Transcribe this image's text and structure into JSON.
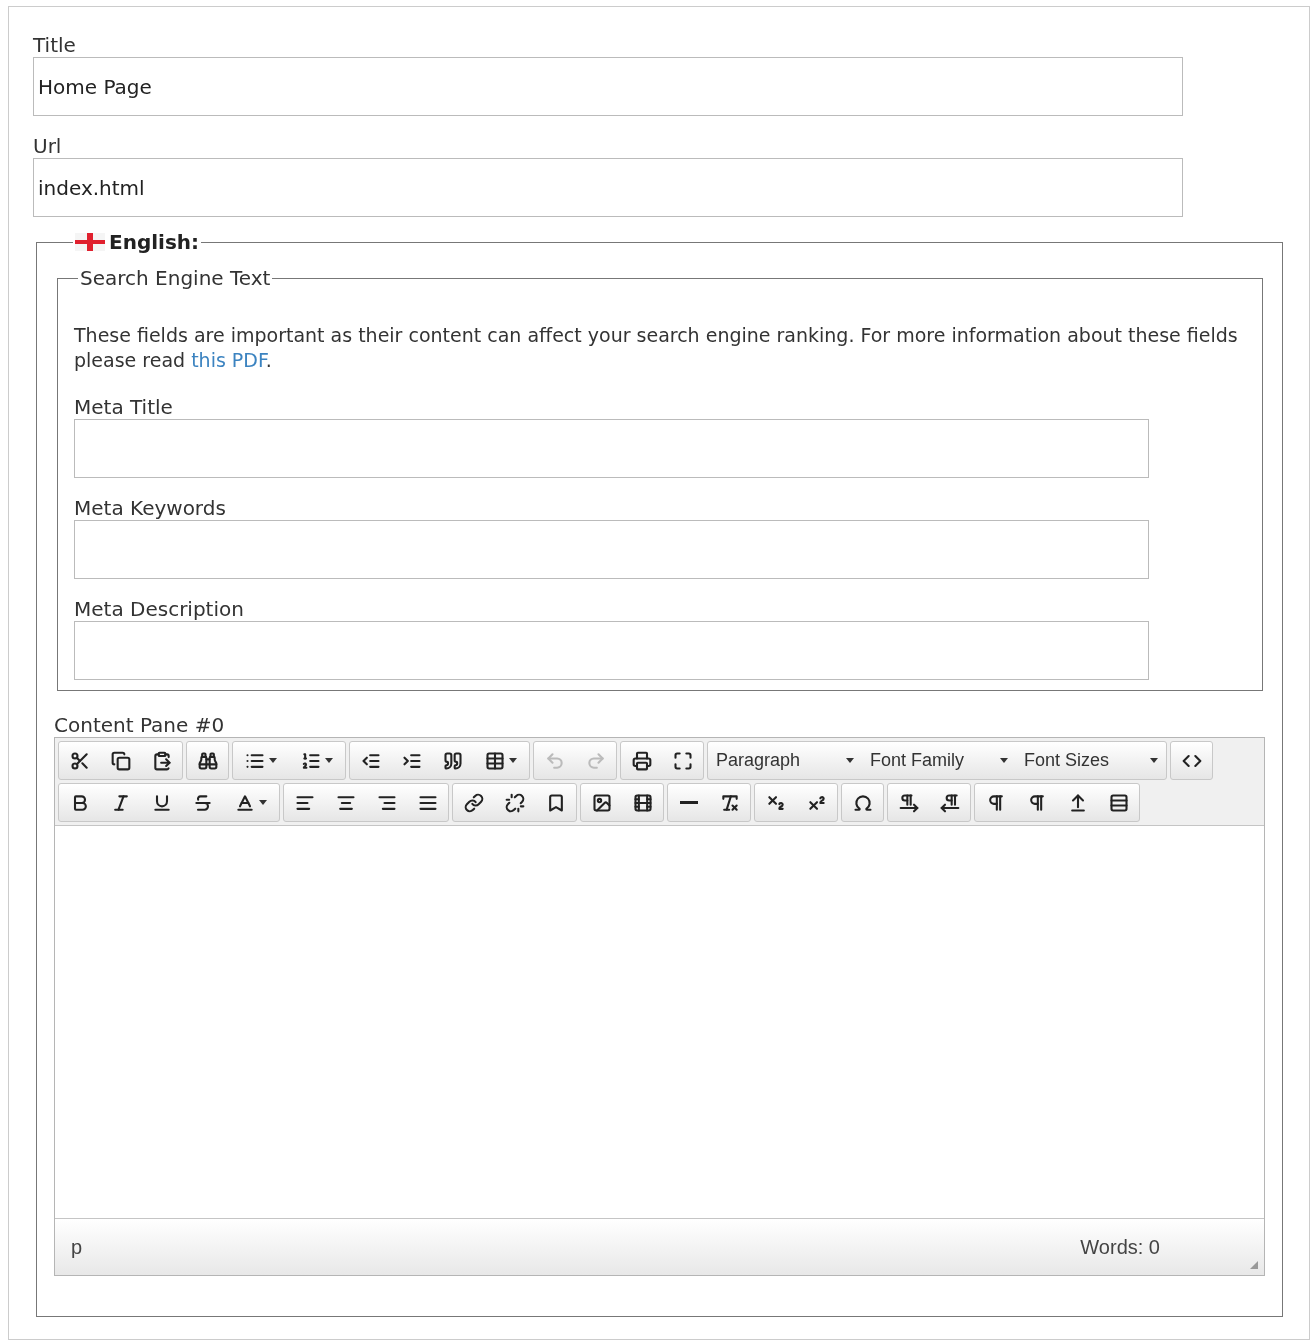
{
  "fields": [
    {
      "label": "Title",
      "value": "Home Page"
    },
    {
      "label": "Url",
      "value": "index.html"
    }
  ],
  "language": {
    "legend": "English:"
  },
  "seo": {
    "legend": "Search Engine Text",
    "intro": "These fields are important as their content can affect your search engine ranking. For more information about these fields please read ",
    "link": "this PDF",
    "intro_end": ".",
    "fields": [
      {
        "label": "Meta Title"
      },
      {
        "label": "Meta Keywords"
      },
      {
        "label": "Meta Description"
      }
    ]
  },
  "editor": {
    "label": "Content Pane #0",
    "toolbar": [
      [
        [
          {
            "kind": "button",
            "disabled": false
          },
          {
            "kind": "button",
            "disabled": false
          },
          {
            "kind": "button",
            "disabled": false
          }
        ],
        [
          {
            "kind": "button",
            "disabled": false
          }
        ],
        [
          {
            "kind": "split",
            "disabled": false
          },
          {
            "kind": "split",
            "disabled": false
          }
        ],
        [
          {
            "kind": "button",
            "disabled": false
          },
          {
            "kind": "button",
            "disabled": false
          },
          {
            "kind": "button",
            "disabled": false
          },
          {
            "kind": "split",
            "disabled": false
          }
        ],
        [
          {
            "kind": "button",
            "disabled": true
          },
          {
            "kind": "button",
            "disabled": true
          }
        ],
        [
          {
            "kind": "button",
            "disabled": false
          },
          {
            "kind": "button",
            "disabled": false
          }
        ],
        [
          {
            "kind": "menu",
            "label": "Paragraph"
          },
          {
            "kind": "menu",
            "label": "Font Family"
          },
          {
            "kind": "menu",
            "label": "Font Sizes"
          }
        ],
        [
          {
            "kind": "button",
            "disabled": false
          }
        ]
      ],
      [
        [
          {
            "kind": "button",
            "disabled": false
          },
          {
            "kind": "button",
            "disabled": false
          },
          {
            "kind": "button",
            "disabled": false
          },
          {
            "kind": "button",
            "disabled": false
          },
          {
            "kind": "split",
            "disabled": false
          }
        ],
        [
          {
            "kind": "button",
            "disabled": false
          },
          {
            "kind": "button",
            "disabled": false
          },
          {
            "kind": "button",
            "disabled": false
          },
          {
            "kind": "button",
            "disabled": false
          }
        ],
        [
          {
            "kind": "button",
            "disabled": false
          },
          {
            "kind": "button",
            "disabled": false
          },
          {
            "kind": "button",
            "disabled": false
          }
        ],
        [
          {
            "kind": "button",
            "disabled": false
          },
          {
            "kind": "button",
            "disabled": false
          }
        ],
        [
          {
            "kind": "button",
            "disabled": false
          },
          {
            "kind": "button",
            "disabled": false
          }
        ],
        [
          {
            "kind": "button",
            "disabled": false
          },
          {
            "kind": "button",
            "disabled": false
          }
        ],
        [
          {
            "kind": "button",
            "disabled": false
          }
        ],
        [
          {
            "kind": "button",
            "disabled": false
          },
          {
            "kind": "button",
            "disabled": false
          }
        ],
        [
          {
            "kind": "button",
            "disabled": false
          },
          {
            "kind": "button",
            "disabled": false
          },
          {
            "kind": "button",
            "disabled": false
          },
          {
            "kind": "button",
            "disabled": false
          }
        ]
      ]
    ],
    "path": "p",
    "word_count": "Words: 0"
  }
}
